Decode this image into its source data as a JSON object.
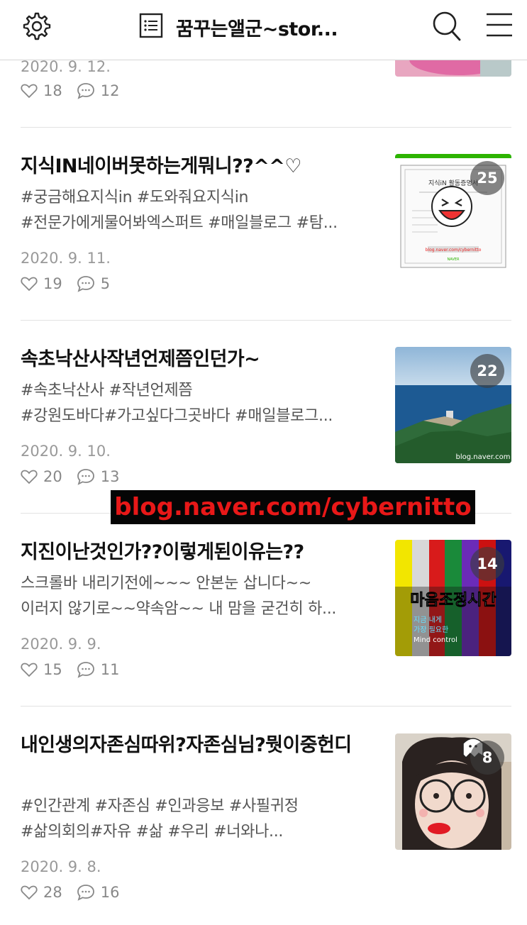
{
  "header": {
    "title": "꿈꾸는앨군~stor...",
    "icons": [
      "gear-icon",
      "list-icon",
      "search-icon",
      "menu-icon"
    ]
  },
  "posts": [
    {
      "title": "",
      "excerpt": [],
      "date": "2020. 9. 12.",
      "likes": "18",
      "comments": "12",
      "badge": ""
    },
    {
      "title": "지식IN네이버못하는게뭐니??^^♡",
      "excerpt": [
        "#궁금해요지식in #도와줘요지식in",
        "#전문가에게물어봐엑스퍼트 #매일블로그 #탐..."
      ],
      "date": "2020. 9. 11.",
      "likes": "19",
      "comments": "5",
      "badge": "25",
      "thumb_text": {
        "heading": "지식iN 활동증명서",
        "link": "blog.naver.com/cybernitto",
        "logo": "NAVER"
      }
    },
    {
      "title": "속초낙산사작년언제쯤인던가~",
      "excerpt": [
        "#속초낙산사 #작년언제쯤",
        "#강원도바다#가고싶다그곳바다 #매일블로그..."
      ],
      "date": "2020. 9. 10.",
      "likes": "20",
      "comments": "13",
      "badge": "22",
      "thumb_text": {
        "watermark": "blog.naver.com"
      }
    },
    {
      "title": "지진이난것인가??이렇게된이유는??",
      "excerpt": [
        "스크롤바 내리기전에~~~ 안본눈 삽니다~~",
        "이러지 않기로~~약속암~~ 내 맘을 굳건히 하..."
      ],
      "date": "2020. 9. 9.",
      "likes": "15",
      "comments": "11",
      "badge": "14",
      "thumb_text": {
        "main": "마음조정시간",
        "line1": "지금 내게",
        "line2": "가장 필요한",
        "line3": "Mind control"
      }
    },
    {
      "title": "내인생의자존심따위?자존심님?뭣이중헌디",
      "excerpt": [
        "#인간관계 #자존심 #인과응보 #사필귀정",
        "#삶의회의#자유 #삶 #우리 #너와나..."
      ],
      "date": "2020. 9. 8.",
      "likes": "28",
      "comments": "16",
      "badge": "8"
    }
  ],
  "overlay": {
    "watermark": "blog.naver.com/cybernitto"
  },
  "colors": {
    "divider": "#e2e2e2",
    "date": "#999999",
    "excerpt": "#555555",
    "watermark_text": "#e81818",
    "watermark_bg": "#050505"
  }
}
